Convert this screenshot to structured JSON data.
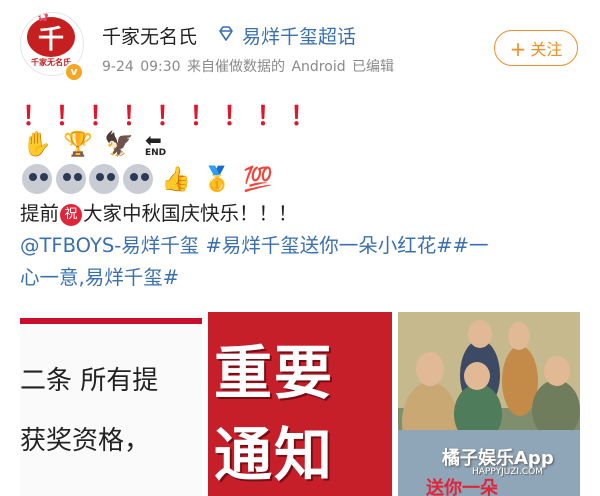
{
  "post": {
    "username": "千家无名氏",
    "topic": "易烊千玺超话",
    "meta": "9-24 09:30 来自催做数据的 Android 已编辑",
    "follow_label": "关注",
    "avatar_char": "千",
    "avatar_caption": "千家无名氏"
  },
  "content": {
    "exclaim_row": [
      "！",
      "！",
      "！",
      "！",
      "！",
      "！",
      "！",
      "！",
      "！"
    ],
    "emoji_row2": [
      "✋",
      "🏆",
      "🦅"
    ],
    "end_label": "END",
    "emoji_row3_tail": [
      "👍",
      "🥇",
      "💯"
    ],
    "line1_before": "提前",
    "line1_badge": "祝",
    "line1_after": "大家中秋国庆快乐！！！",
    "line2": "@TFBOYS-易烊千玺 #易烊千玺送你一朵小红花##一",
    "line3": "心一意,易烊千玺#"
  },
  "images": {
    "img1_line1": "二条 所有提",
    "img1_line2": "获奖资格，",
    "img2_line1": "重要",
    "img2_line2": "通知",
    "img3_watermark": "橘子娱乐App",
    "img3_url": "HAPPYJUZI.COM",
    "img3_stamp": "送你一朵"
  },
  "colors": {
    "accent": "#f08e27",
    "link": "#3a6fb0",
    "red": "#e0162b"
  }
}
